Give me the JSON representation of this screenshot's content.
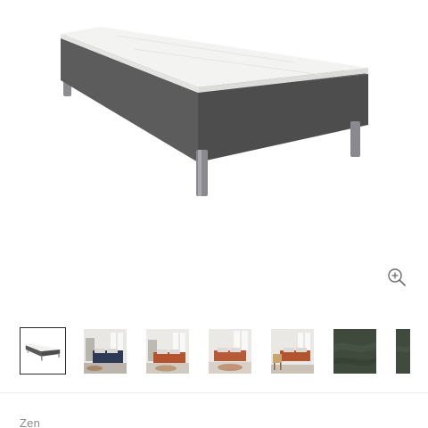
{
  "product": {
    "name": "Zen"
  },
  "gallery": {
    "zoom_icon": "zoom-in-icon",
    "selected_index": 0,
    "thumbnails": [
      {
        "kind": "bed-product"
      },
      {
        "kind": "bedroom-navy-bedding"
      },
      {
        "kind": "bedroom-rust-bedding"
      },
      {
        "kind": "bedroom-rust-bedding-rug"
      },
      {
        "kind": "bedroom-rust-bedding-chair"
      },
      {
        "kind": "fabric-swatch-green"
      },
      {
        "kind": "fabric-swatch-green-partial"
      }
    ]
  },
  "colors": {
    "upholstery": "#5a5a5a",
    "mattress": "#f4f4f2",
    "legs": "#8c8c90",
    "swatch": "#3f4a3c"
  }
}
